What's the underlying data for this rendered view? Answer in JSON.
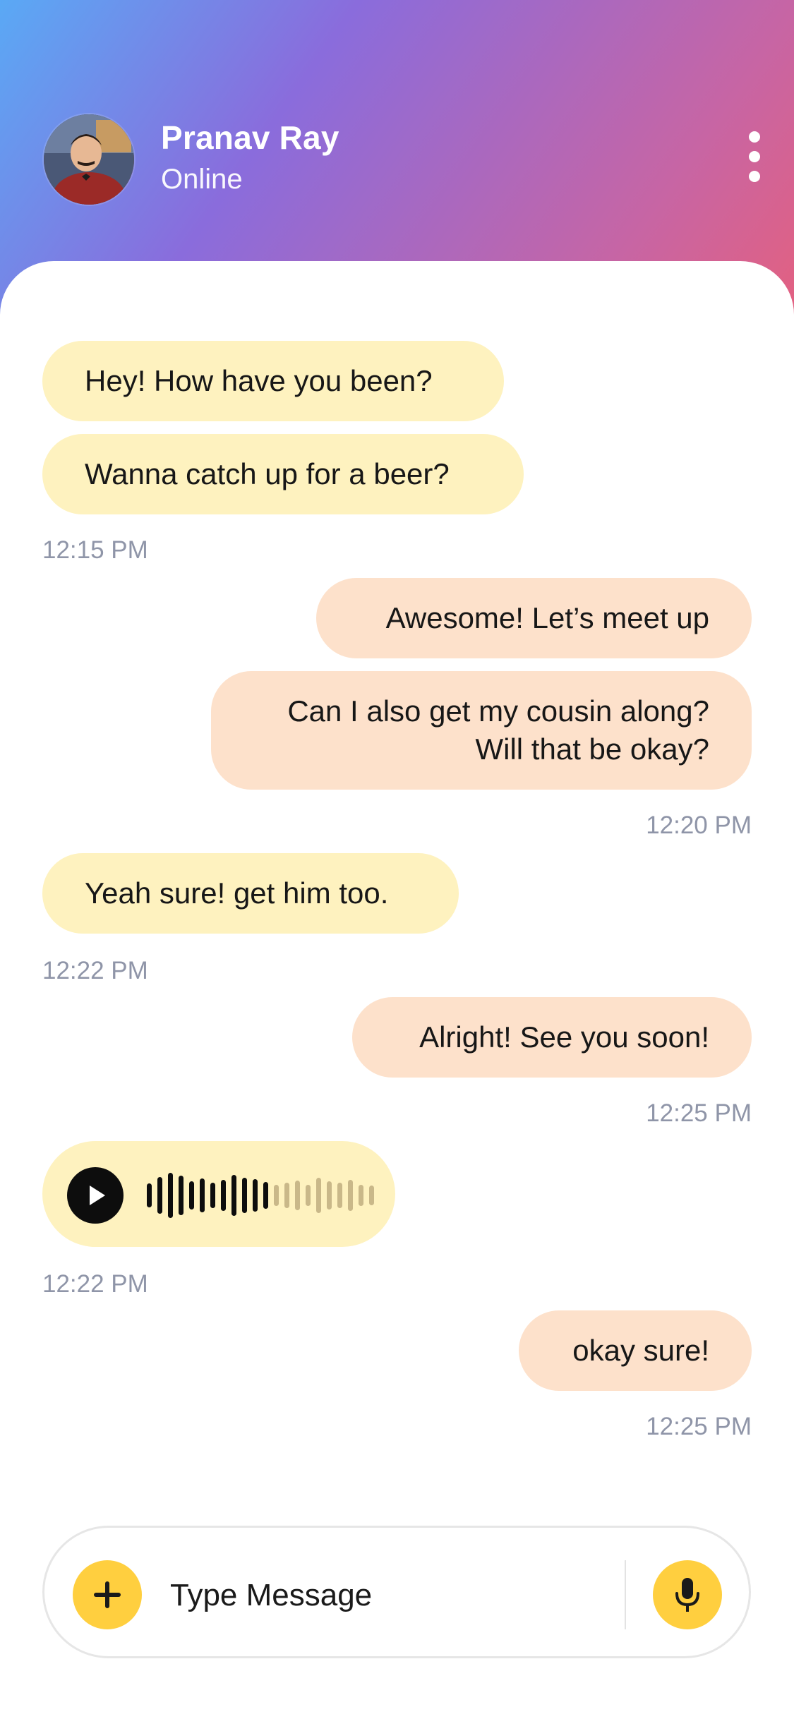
{
  "header": {
    "contact_name": "Pranav Ray",
    "status": "Online",
    "avatar_alt": "avatar",
    "menu_icon": "more-vertical-icon"
  },
  "messages": [
    {
      "side": "incoming",
      "text": "Hey! How have you been?"
    },
    {
      "side": "incoming",
      "text": "Wanna catch up for a beer?"
    },
    {
      "side": "time",
      "text": "12:15 PM"
    },
    {
      "side": "outgoing",
      "text": "Awesome! Let’s meet up"
    },
    {
      "side": "outgoing",
      "line1": "Can I also get my cousin along?",
      "line2": "Will that be okay?"
    },
    {
      "side": "time",
      "text": "12:20 PM"
    },
    {
      "side": "incoming",
      "text": "Yeah sure! get him too."
    },
    {
      "side": "time",
      "text": "12:22 PM"
    },
    {
      "side": "outgoing",
      "text": "Alright! See you soon!"
    },
    {
      "side": "time",
      "text": "12:25 PM"
    },
    {
      "side": "voice",
      "played_fraction": 0.55
    },
    {
      "side": "time",
      "text": "12:22 PM"
    },
    {
      "side": "outgoing",
      "text": "okay sure!"
    },
    {
      "side": "time",
      "text": "12:25 PM"
    }
  ],
  "composer": {
    "placeholder": "Type Message",
    "add_icon": "plus-icon",
    "mic_icon": "microphone-icon"
  },
  "colors": {
    "incoming_bubble": "#fef2bf",
    "outgoing_bubble": "#fde1cb",
    "accent": "#ffcf3f",
    "timestamp": "#8f95a8"
  }
}
